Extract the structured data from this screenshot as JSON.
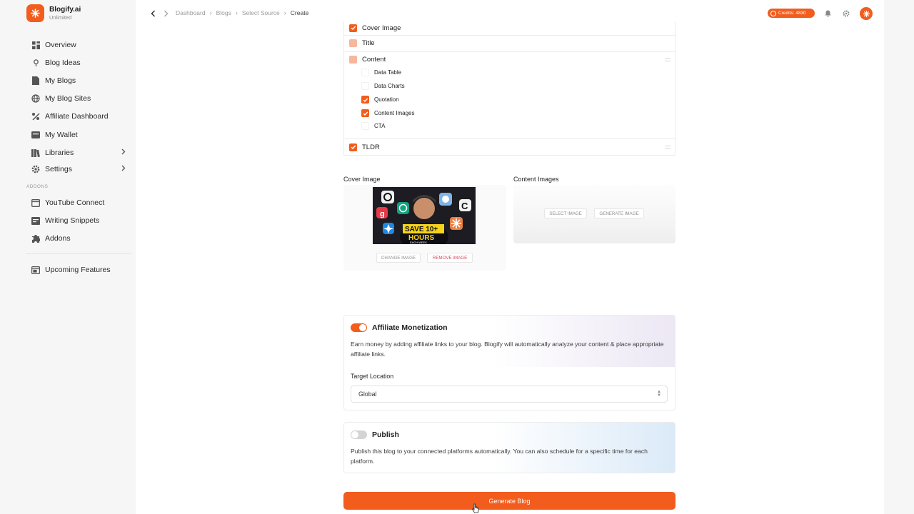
{
  "brand": {
    "name": "Blogify.ai",
    "plan": "Unlimited"
  },
  "sidebar": {
    "items": [
      {
        "label": "Overview",
        "icon": "grid-icon"
      },
      {
        "label": "Blog Ideas",
        "icon": "lightbulb-icon"
      },
      {
        "label": "My Blogs",
        "icon": "document-icon"
      },
      {
        "label": "My Blog Sites",
        "icon": "globe-icon"
      },
      {
        "label": "Affiliate Dashboard",
        "icon": "affiliate-icon"
      },
      {
        "label": "My Wallet",
        "icon": "wallet-icon"
      },
      {
        "label": "Libraries",
        "icon": "library-icon"
      },
      {
        "label": "Settings",
        "icon": "gear-icon"
      }
    ],
    "section_label": "ADDONS",
    "addons": [
      {
        "label": "YouTube Connect",
        "icon": "youtube-icon"
      },
      {
        "label": "Writing Snippets",
        "icon": "snippet-icon"
      },
      {
        "label": "Addons",
        "icon": "puzzle-icon"
      }
    ],
    "upcoming": {
      "label": "Upcoming Features",
      "icon": "calendar-icon"
    }
  },
  "breadcrumb": [
    "Dashboard",
    "Blogs",
    "Select Source",
    "Create"
  ],
  "topbar": {
    "credits": "Credits: 4830"
  },
  "structure": {
    "rows": [
      {
        "label": "Cover Image",
        "state": "on"
      },
      {
        "label": "Title",
        "state": "light"
      },
      {
        "label": "Content",
        "state": "light"
      },
      {
        "label": "TLDR",
        "state": "on"
      }
    ],
    "content_items": [
      {
        "label": "Data Table",
        "state": "off"
      },
      {
        "label": "Data Charts",
        "state": "off"
      },
      {
        "label": "Quotation",
        "state": "on"
      },
      {
        "label": "Content Images",
        "state": "on"
      },
      {
        "label": "CTA",
        "state": "off"
      }
    ]
  },
  "images": {
    "cover_label": "Cover Image",
    "content_label": "Content Images",
    "change_image": "CHANGE IMAGE",
    "remove_image": "REMOVE IMAGE",
    "select_image": "SELECT IMAGE",
    "generate_image": "GENERATE IMAGE",
    "thumb_text_line1": "SAVE 10+",
    "thumb_text_line2": "HOURS",
    "thumb_text_line3": "EACH WEEK"
  },
  "affiliate": {
    "enabled": true,
    "title": "Affiliate Monetization",
    "description": "Earn money by adding affiliate links to your blog. Blogify will automatically analyze your content & place appropriate affiliate links.",
    "target_label": "Target Location",
    "target_value": "Global"
  },
  "publish": {
    "enabled": false,
    "title": "Publish",
    "description": "Publish this blog to your connected platforms automatically. You can also schedule for a specific time for each platform."
  },
  "generate_button": "Generate Blog",
  "colors": {
    "accent": "#f25c1d",
    "accent_light": "#f7b79c",
    "danger_text": "#e0455a"
  }
}
